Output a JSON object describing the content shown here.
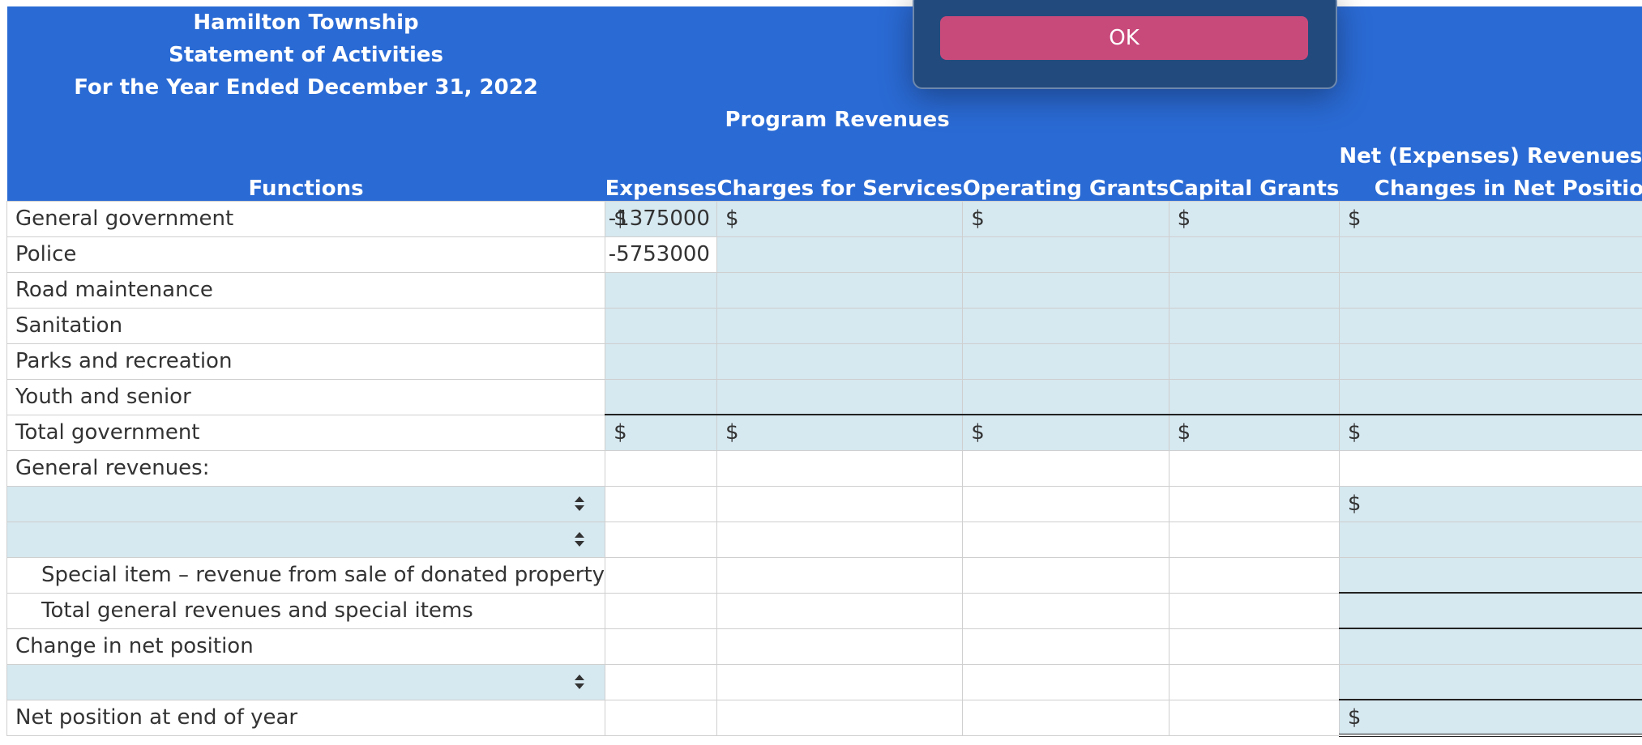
{
  "header": {
    "title_line1": "Hamilton Township",
    "title_line2": "Statement of Activities",
    "title_line3": "For the Year Ended December 31, 2022",
    "program_revenues": "Program Revenues",
    "net_line1": "Net (Expenses) Revenues and",
    "net_line2": "Changes in Net Position",
    "functions": "Functions",
    "expenses": "Expenses",
    "charges": "Charges for Services",
    "operating": "Operating Grants",
    "capital": "Capital Grants"
  },
  "currency_symbol": "$",
  "rows": {
    "general_government": {
      "label": "General government",
      "expenses": "-1375000"
    },
    "police": {
      "label": "Police",
      "expenses": "-5753000"
    },
    "road_maintenance": {
      "label": "Road maintenance"
    },
    "sanitation": {
      "label": "Sanitation"
    },
    "parks": {
      "label": "Parks and recreation"
    },
    "youth": {
      "label": "Youth and senior"
    },
    "total_government": {
      "label": "Total government"
    },
    "general_revenues": {
      "label": "General revenues:"
    },
    "special_item": {
      "label": "Special item – revenue from sale of donated property"
    },
    "total_general": {
      "label": "Total general revenues and special items"
    },
    "change_net": {
      "label": "Change in net position"
    },
    "net_end": {
      "label": "Net position at end of year"
    }
  },
  "dialog": {
    "ok_label": "OK"
  },
  "colors": {
    "header_bg": "#2a6ad4",
    "input_bg": "#d6e8f0",
    "ok_button": "#c84a7b",
    "dialog_bg": "#234a7c"
  }
}
